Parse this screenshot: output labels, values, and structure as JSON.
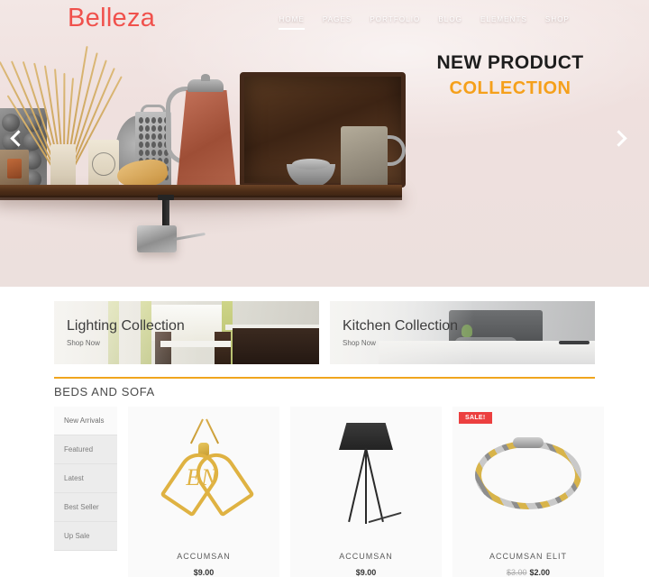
{
  "header": {
    "logo": "Belleza",
    "nav": [
      {
        "label": "HOME",
        "active": true
      },
      {
        "label": "PAGES",
        "active": false
      },
      {
        "label": "PORTFOLIO",
        "active": false
      },
      {
        "label": "BLOG",
        "active": false
      },
      {
        "label": "ELEMENTS",
        "active": false
      },
      {
        "label": "SHOP",
        "active": false
      }
    ]
  },
  "hero": {
    "line1": "NEW PRODUCT",
    "line2": "COLLECTION",
    "prev_icon": "chevron-left-icon",
    "next_icon": "chevron-right-icon",
    "accent_color": "#f5a01b",
    "logo_color": "#f0514c"
  },
  "banners": [
    {
      "title": "Lighting Collection",
      "cta": "Shop Now"
    },
    {
      "title": "Kitchen Collection",
      "cta": "Shop Now"
    }
  ],
  "section": {
    "title": "BEDS AND SOFA",
    "rule_color": "#f0a51e",
    "tabs": [
      {
        "label": "New Arrivals",
        "active": true
      },
      {
        "label": "Featured",
        "active": false
      },
      {
        "label": "Latest",
        "active": false
      },
      {
        "label": "Best Seller",
        "active": false
      },
      {
        "label": "Up Sale",
        "active": false
      }
    ],
    "products": [
      {
        "name": "ACCUMSAN",
        "price": "$9.00",
        "old_price": "",
        "badge": "",
        "image": "gold-heart-pendant-necklace",
        "initials": "EN"
      },
      {
        "name": "ACCUMSAN",
        "price": "$9.00",
        "old_price": "",
        "badge": "",
        "image": "black-tripod-floor-lamp"
      },
      {
        "name": "ACCUMSAN ELIT",
        "price": "$2.00",
        "old_price": "$3.00",
        "badge": "SALE!",
        "badge_color": "#ec3f3f",
        "image": "gold-silver-link-bracelet"
      }
    ]
  }
}
